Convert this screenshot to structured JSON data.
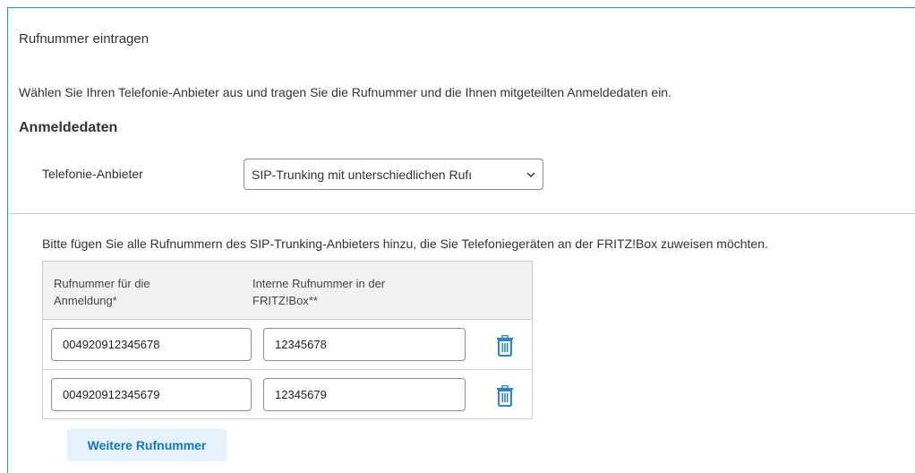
{
  "section": {
    "title": "Rufnummer eintragen"
  },
  "intro": "Wählen Sie Ihren Telefonie-Anbieter aus und tragen Sie die Rufnummer und die Ihnen mitgeteilten Anmeldedaten ein.",
  "login": {
    "heading": "Anmeldedaten",
    "provider_label": "Telefonie-Anbieter",
    "provider_value": "SIP-Trunking mit unterschiedlichen Rufı"
  },
  "hint": "Bitte fügen Sie alle Rufnummern des SIP-Trunking-Anbieters hinzu, die Sie Telefoniegeräten an der FRITZ!Box zuweisen möchten.",
  "table": {
    "col1_line1": "Rufnummer für die",
    "col1_line2": "Anmeldung*",
    "col2_line1": "Interne Rufnummer in der",
    "col2_line2": "FRITZ!Box**",
    "rows": [
      {
        "number": "004920912345678",
        "internal": "12345678"
      },
      {
        "number": "004920912345679",
        "internal": "12345679"
      }
    ]
  },
  "add_button": "Weitere Rufnummer",
  "colors": {
    "accent": "#1aa29b",
    "link": "#1277b8",
    "button_bg": "#e6f2fb"
  },
  "icons": {
    "delete": "trash-icon",
    "select": "chevron-down-icon"
  }
}
